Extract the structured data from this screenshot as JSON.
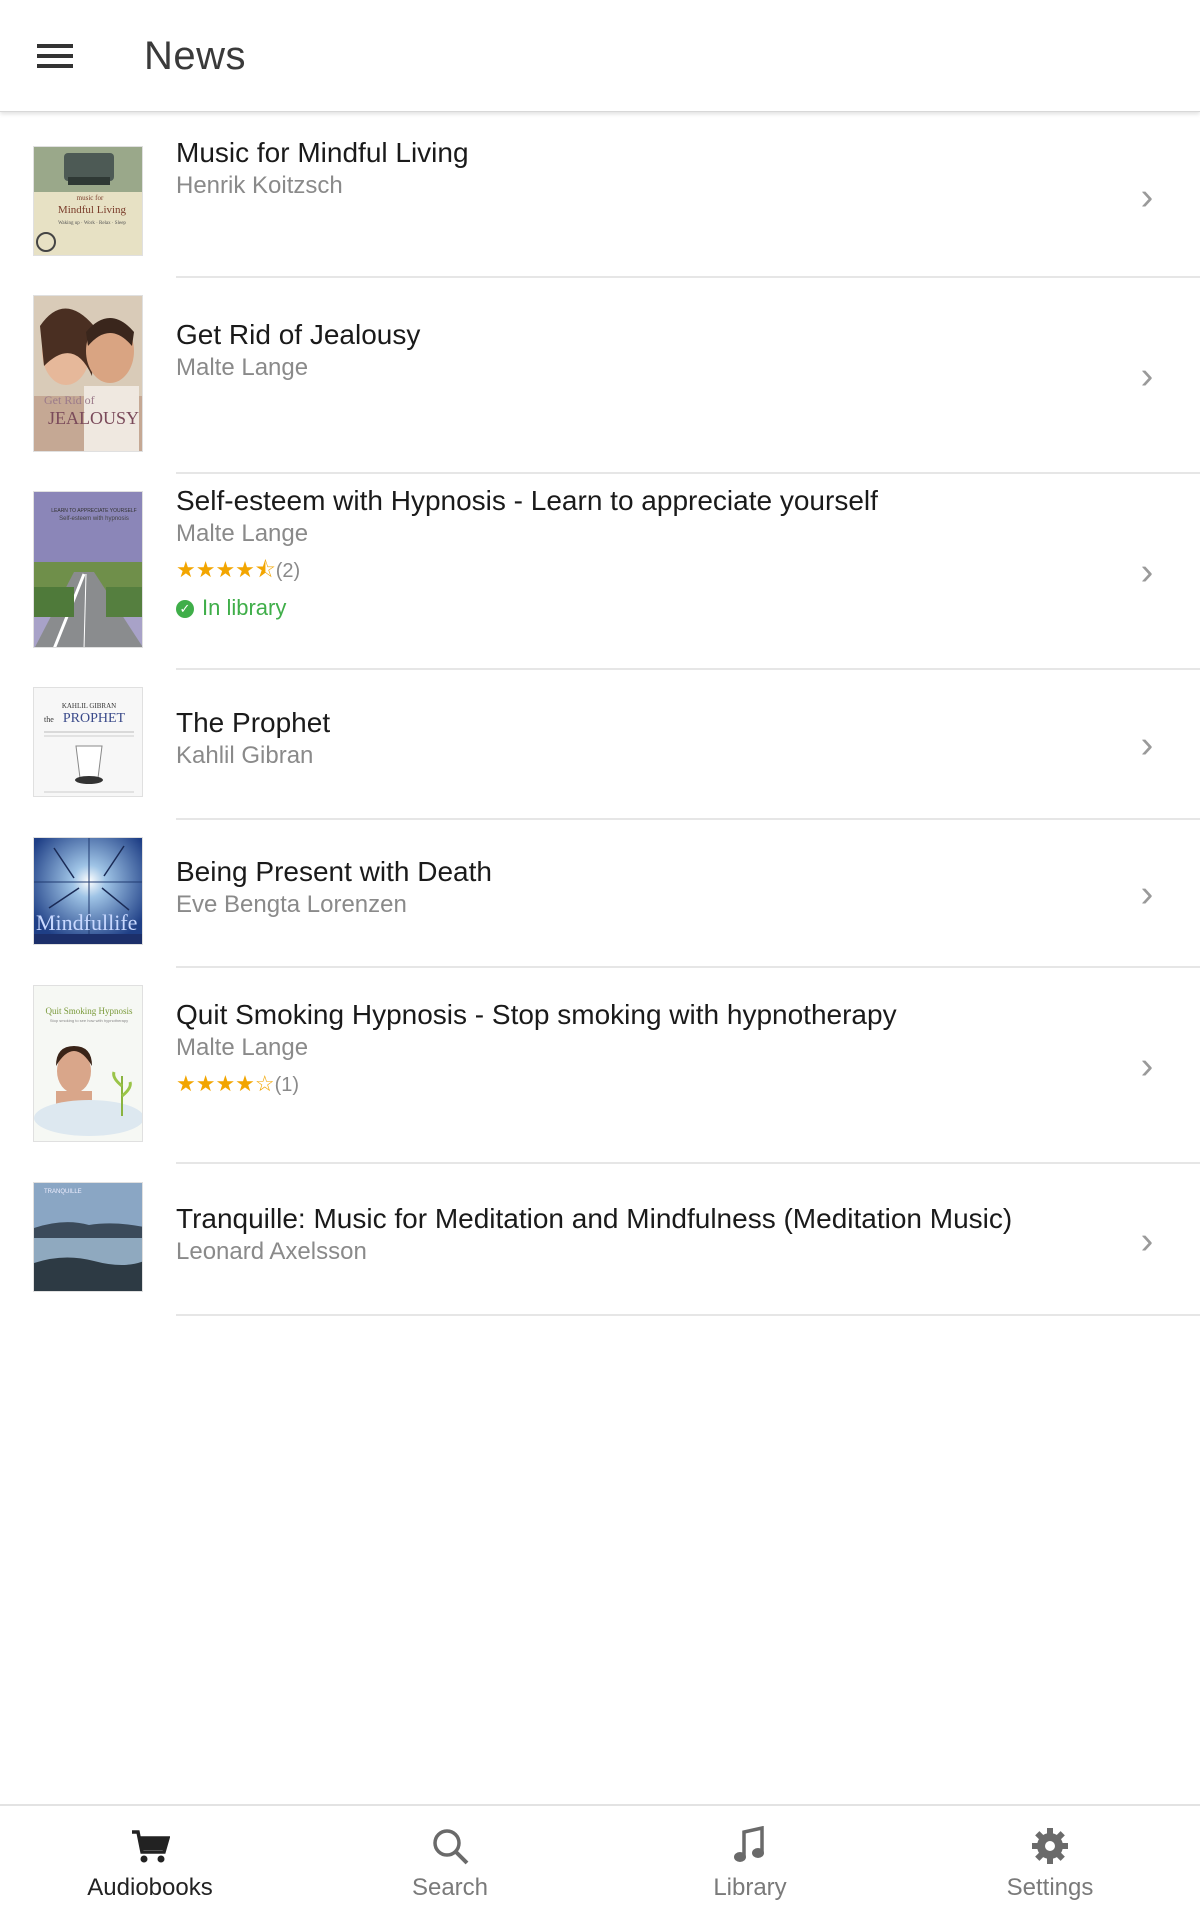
{
  "header": {
    "title": "News",
    "menu_icon": "hamburger-menu-icon"
  },
  "items": [
    {
      "title": "Music for Mindful Living",
      "author": "Henrik Koitzsch",
      "rating": null,
      "rating_count": null,
      "in_library": null,
      "cover_text": "music for Mindful Living"
    },
    {
      "title": "Get Rid of Jealousy",
      "author": "Malte Lange",
      "rating": null,
      "rating_count": null,
      "in_library": null,
      "cover_text": "Get Rid of JEALOUSY"
    },
    {
      "title": "Self-esteem with Hypnosis - Learn to appreciate yourself",
      "author": "Malte Lange",
      "rating": "★★★★⯪",
      "rating_count": "(2)",
      "in_library": "In library",
      "cover_text": ""
    },
    {
      "title": "The Prophet",
      "author": "Kahlil Gibran",
      "rating": null,
      "rating_count": null,
      "in_library": null,
      "cover_text": "KAHLIL GIBRAN the PROPHET"
    },
    {
      "title": "Being Present with Death",
      "author": "Eve Bengta Lorenzen",
      "rating": null,
      "rating_count": null,
      "in_library": null,
      "cover_text": "Mindfullife"
    },
    {
      "title": "Quit Smoking Hypnosis - Stop smoking with hypnotherapy",
      "author": "Malte Lange",
      "rating": "★★★★☆",
      "rating_count": "(1)",
      "in_library": null,
      "cover_text": "Quit Smoking Hypnosis"
    },
    {
      "title": "Tranquille: Music for Meditation and Mindfulness (Meditation Music)",
      "author": "Leonard Axelsson",
      "rating": null,
      "rating_count": null,
      "in_library": null,
      "cover_text": ""
    }
  ],
  "tabs": [
    {
      "label": "Audiobooks",
      "icon": "cart-icon",
      "active": true
    },
    {
      "label": "Search",
      "icon": "search-icon",
      "active": false
    },
    {
      "label": "Library",
      "icon": "music-note-icon",
      "active": false
    },
    {
      "label": "Settings",
      "icon": "gear-icon",
      "active": false
    }
  ],
  "colors": {
    "star": "#f2a500",
    "in_library": "#3fae49",
    "secondary_text": "#8a8a8a"
  }
}
